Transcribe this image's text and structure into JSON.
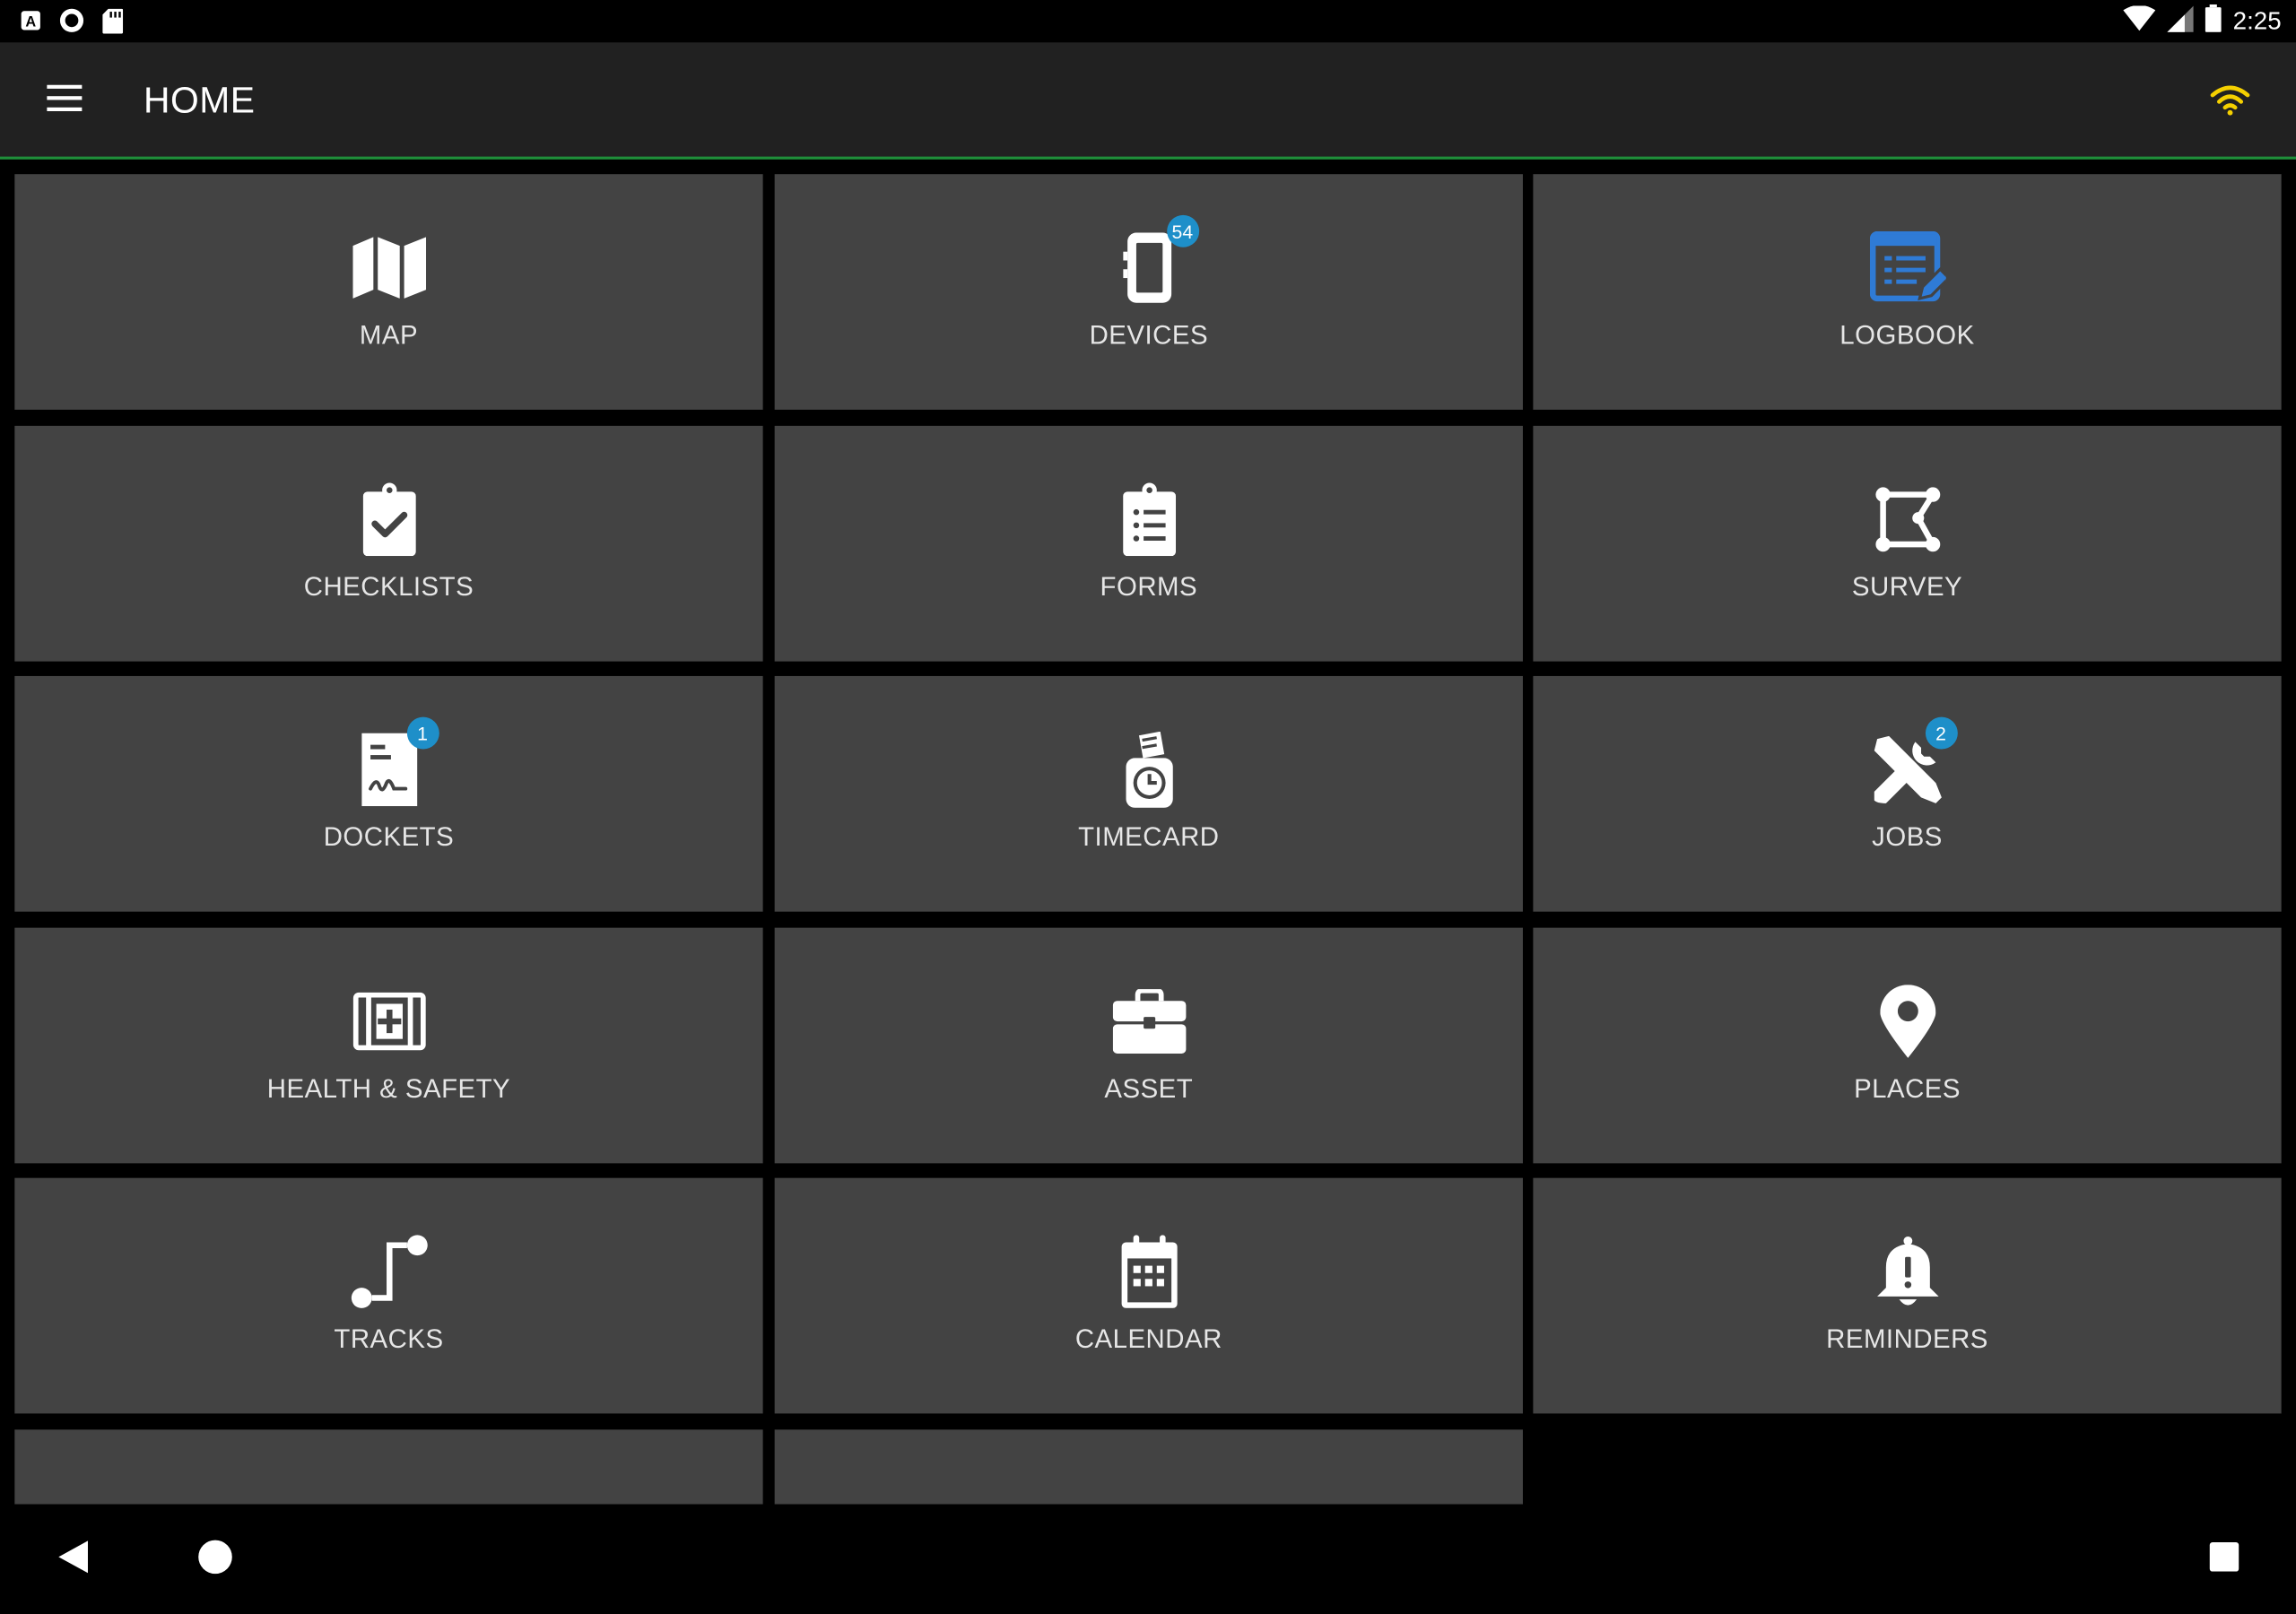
{
  "status_bar": {
    "time": "2:25",
    "left_icons": [
      "text-a-icon",
      "circle-record-icon",
      "sd-card-icon"
    ],
    "right_icons": [
      "wifi-signal-icon",
      "cell-signal-icon",
      "battery-icon"
    ]
  },
  "app_bar": {
    "menu_icon": "hamburger-menu-icon",
    "title": "HOME",
    "connection_icon": "wifi-icon",
    "connection_color": "#f5d000",
    "accent_line_color": "#1f8f3a"
  },
  "tiles": [
    {
      "label": "MAP",
      "icon": "map-icon",
      "badge": ""
    },
    {
      "label": "DEVICES",
      "icon": "device-icon",
      "badge": "54"
    },
    {
      "label": "LOGBOOK",
      "icon": "logbook-icon",
      "badge": "",
      "icon_color": "#2f7bd6"
    },
    {
      "label": "CHECKLISTS",
      "icon": "clipboard-check-icon",
      "badge": ""
    },
    {
      "label": "FORMS",
      "icon": "clipboard-list-icon",
      "badge": ""
    },
    {
      "label": "SURVEY",
      "icon": "polygon-icon",
      "badge": ""
    },
    {
      "label": "DOCKETS",
      "icon": "docket-signature-icon",
      "badge": "1"
    },
    {
      "label": "TIMECARD",
      "icon": "timecard-clock-icon",
      "badge": ""
    },
    {
      "label": "JOBS",
      "icon": "tools-icon",
      "badge": "2"
    },
    {
      "label": "HEALTH & SAFETY",
      "icon": "first-aid-icon",
      "badge": ""
    },
    {
      "label": "ASSET",
      "icon": "briefcase-icon",
      "badge": ""
    },
    {
      "label": "PLACES",
      "icon": "map-pin-icon",
      "badge": ""
    },
    {
      "label": "TRACKS",
      "icon": "route-icon",
      "badge": ""
    },
    {
      "label": "CALENDAR",
      "icon": "calendar-icon",
      "badge": ""
    },
    {
      "label": "REMINDERS",
      "icon": "bell-alert-icon",
      "badge": ""
    }
  ],
  "partial_tiles": [
    {
      "icon": "partial-icon-1"
    },
    {
      "icon": "partial-icon-2"
    }
  ],
  "colors": {
    "tile_background": "#434343",
    "badge": "#1e8fc9",
    "app_bar": "#212121"
  },
  "nav_bar": {
    "back": "back-triangle-icon",
    "home": "home-circle-icon",
    "recents": "recents-square-icon"
  }
}
